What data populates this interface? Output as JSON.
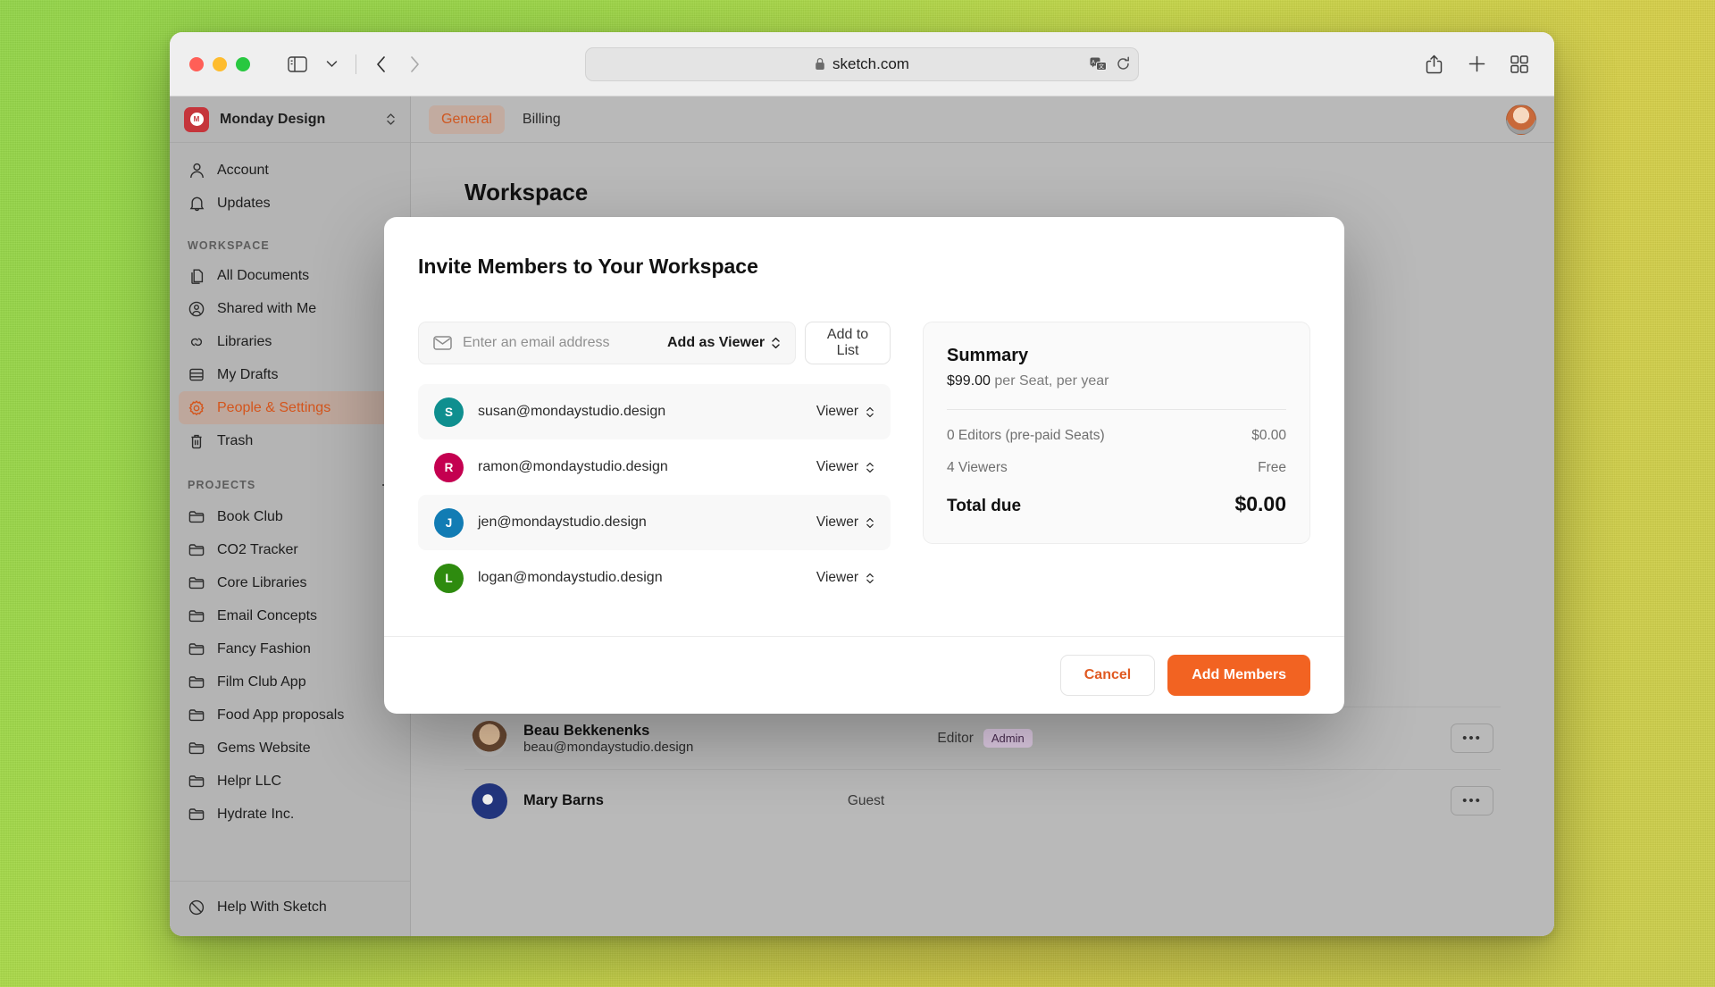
{
  "browser": {
    "url": "sketch.com",
    "lock_icon": "lock-icon",
    "sidebar_toggle_icon": "sidebar-toggle-icon",
    "sidebar_chevron_icon": "chevron-down-icon",
    "back_icon": "chevron-left-icon",
    "forward_icon": "chevron-right-icon",
    "translate_icon": "translate-icon",
    "reload_icon": "reload-icon",
    "share_icon": "share-icon",
    "new_tab_icon": "plus-icon",
    "tab_overview_icon": "tab-overview-icon"
  },
  "sidebar": {
    "workspace_name": "Monday Design",
    "workspace_logo": "monday-design-logo",
    "top_items": [
      {
        "label": "Account",
        "icon": "person-icon"
      },
      {
        "label": "Updates",
        "icon": "bell-icon"
      }
    ],
    "workspace_section_label": "WORKSPACE",
    "workspace_items": [
      {
        "label": "All Documents",
        "icon": "documents-icon",
        "active": false
      },
      {
        "label": "Shared with Me",
        "icon": "shared-person-icon",
        "active": false
      },
      {
        "label": "Libraries",
        "icon": "libraries-icon",
        "active": false
      },
      {
        "label": "My Drafts",
        "icon": "drafts-icon",
        "active": false
      },
      {
        "label": "People & Settings",
        "icon": "gear-icon",
        "active": true
      },
      {
        "label": "Trash",
        "icon": "trash-icon",
        "active": false
      }
    ],
    "projects_section_label": "PROJECTS",
    "projects_add_icon": "plus-icon",
    "projects": [
      {
        "label": "Book Club",
        "icon": "folder-icon"
      },
      {
        "label": "CO2 Tracker",
        "icon": "folder-icon"
      },
      {
        "label": "Core Libraries",
        "icon": "folder-icon"
      },
      {
        "label": "Email Concepts",
        "icon": "folder-icon"
      },
      {
        "label": "Fancy Fashion",
        "icon": "folder-icon"
      },
      {
        "label": "Film Club App",
        "icon": "folder-icon"
      },
      {
        "label": "Food App proposals",
        "icon": "folder-icon"
      },
      {
        "label": "Gems Website",
        "icon": "folder-icon"
      },
      {
        "label": "Helpr LLC",
        "icon": "folder-icon"
      },
      {
        "label": "Hydrate Inc.",
        "icon": "folder-icon"
      }
    ],
    "help_item": {
      "label": "Help With Sketch",
      "icon": "help-icon"
    }
  },
  "content": {
    "tabs": [
      {
        "label": "General",
        "active": true
      },
      {
        "label": "Billing",
        "active": false
      }
    ],
    "avatar": "user-avatar",
    "page_title": "Workspace",
    "background_rows": [
      {
        "name": "Beau Bekkenenks",
        "email": "beau@mondaystudio.design",
        "role": "Editor",
        "badge": "Admin",
        "menu_icon": "overflow-menu-icon",
        "avatar": "beau-avatar"
      },
      {
        "name": "Mary Barns",
        "email": "",
        "role": "Guest",
        "badge": "",
        "menu_icon": "overflow-menu-icon",
        "avatar": "mary-avatar"
      }
    ]
  },
  "modal": {
    "title": "Invite Members to Your Workspace",
    "invite": {
      "email_placeholder": "Enter an email address",
      "email_value": "",
      "email_icon": "envelope-icon",
      "role_label": "Add as Viewer",
      "role_chevron_icon": "chevron-updown-icon",
      "add_button": "Add to List"
    },
    "members": [
      {
        "initial": "S",
        "email": "susan@mondaystudio.design",
        "role": "Viewer",
        "color": "#0f8f8f",
        "chevron_icon": "chevron-updown-icon"
      },
      {
        "initial": "R",
        "email": "ramon@mondaystudio.design",
        "role": "Viewer",
        "color": "#c40050",
        "chevron_icon": "chevron-updown-icon"
      },
      {
        "initial": "J",
        "email": "jen@mondaystudio.design",
        "role": "Viewer",
        "color": "#127cb4",
        "chevron_icon": "chevron-updown-icon"
      },
      {
        "initial": "L",
        "email": "logan@mondaystudio.design",
        "role": "Viewer",
        "color": "#2e8b0f",
        "chevron_icon": "chevron-updown-icon"
      }
    ],
    "summary": {
      "title": "Summary",
      "price": "$99.00",
      "price_suffix": "per Seat, per year",
      "lines": [
        {
          "label": "0 Editors (pre-paid Seats)",
          "value": "$0.00"
        },
        {
          "label": "4 Viewers",
          "value": "Free"
        }
      ],
      "total_label": "Total due",
      "total_value": "$0.00"
    },
    "footer": {
      "cancel_label": "Cancel",
      "submit_label": "Add Members"
    }
  },
  "colors": {
    "accent": "#f26322",
    "accent_dark": "#d4551c",
    "admin_badge_bg": "#e3cfe8"
  }
}
